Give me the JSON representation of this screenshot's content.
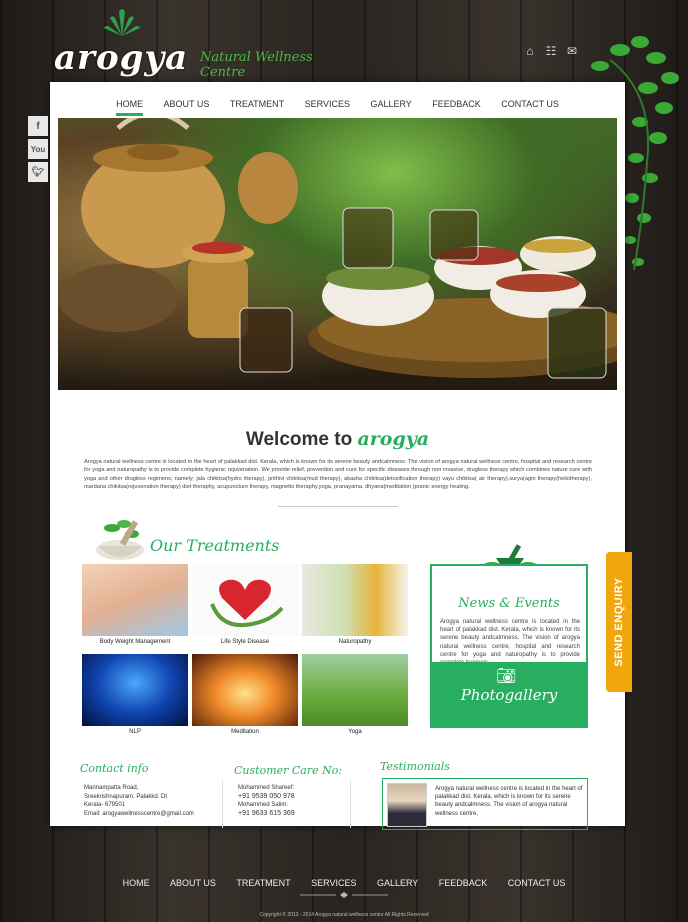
{
  "brand": {
    "logo": "arogya",
    "tagline": "Natural Wellness Centre"
  },
  "top_icons": [
    "home-icon",
    "sitemap-icon",
    "mail-icon"
  ],
  "nav": [
    {
      "label": "HOME",
      "active": true
    },
    {
      "label": "ABOUT US"
    },
    {
      "label": "TREATMENT"
    },
    {
      "label": "SERVICES"
    },
    {
      "label": "GALLERY"
    },
    {
      "label": "FEEDBACK"
    },
    {
      "label": "CONTACT US"
    }
  ],
  "social": [
    "f",
    "You",
    "twitter-icon"
  ],
  "slider": {
    "thumb_count": 4,
    "selected": 1
  },
  "welcome": {
    "prefix": "Welcome to ",
    "brand": "arogya",
    "text": "Arogya natural wellness centre is located in the heart of palakkad dist. Kerala, which is known for its serene beauty andcalmness. The vision of arogya natural wellness centre, hospital and research centre for yoga and naturopathy is to provide complete hygienic rejuvenation. We provide relief, prevention and cure for specific diseases through non invasive, drugless therapy which combines nature cure with yoga and other drugless regimens; namely; jala chikitsa(hydro therapy), prithivi chikitsa(mud therapy), akasha chikitsa(detoxification therapy) vayu chikitsa( air therapy),surya(agni therapy(heliotherapy), mardana chikitsa(rejuvenation therapy) diet theraphy, acupuncture therapy, magnetto theraphy,yoga, pranayama, dhyana(meditation )pranic energy healing."
  },
  "treatments": {
    "title": "Our Treatments",
    "items": [
      {
        "label": "Body Weight Management"
      },
      {
        "label": "Life Style Disease"
      },
      {
        "label": "Naturopathy"
      },
      {
        "label": "NLP"
      },
      {
        "label": "Meditation"
      },
      {
        "label": "Yoga"
      }
    ]
  },
  "news": {
    "title": "News & Events",
    "text": "Arogya natural wellness centre is located in the heart of palakkad dist. Kerala, which is known for its serene beauty andcalmness. The vision of arogya natural wellness centre, hospital and research centre for yoga and naturopathy is to provide complete hygienic",
    "photo_label": "Photogallery"
  },
  "contact": {
    "title": "Contact info",
    "lines": [
      "Mannampatta Road,",
      "Sreekrishnapuram, Palakkd. Dt",
      "Kerala- 679501",
      "Email: arogyawellnesscentre@gmail.com"
    ]
  },
  "customer_care": {
    "title": "Customer Care No:",
    "lines": [
      "Mohammed Shareef:",
      "+91 9539 050 978",
      "Mohammed Salim:",
      "+91 9633 615 369"
    ]
  },
  "testimonials": {
    "title": "Testimonials",
    "text": "Arogya natural wellness centre is located in the heart of palakkad dist. Kerala, which is known for its serene beauty andcalmness. The vision of arogya natural wellness centre,"
  },
  "enquiry": "SEND ENQUIRY",
  "footer_nav": [
    "HOME",
    "ABOUT US",
    "TREATMENT",
    "SERVICES",
    "GALLERY",
    "FEEDBACK",
    "CONTACT US"
  ],
  "copyright": "Copyright © 2013 - 2014 Arogya natural wellness centre All Rights Reserved",
  "colors": {
    "accent": "#27ae60",
    "enquiry": "#f0a60c"
  }
}
